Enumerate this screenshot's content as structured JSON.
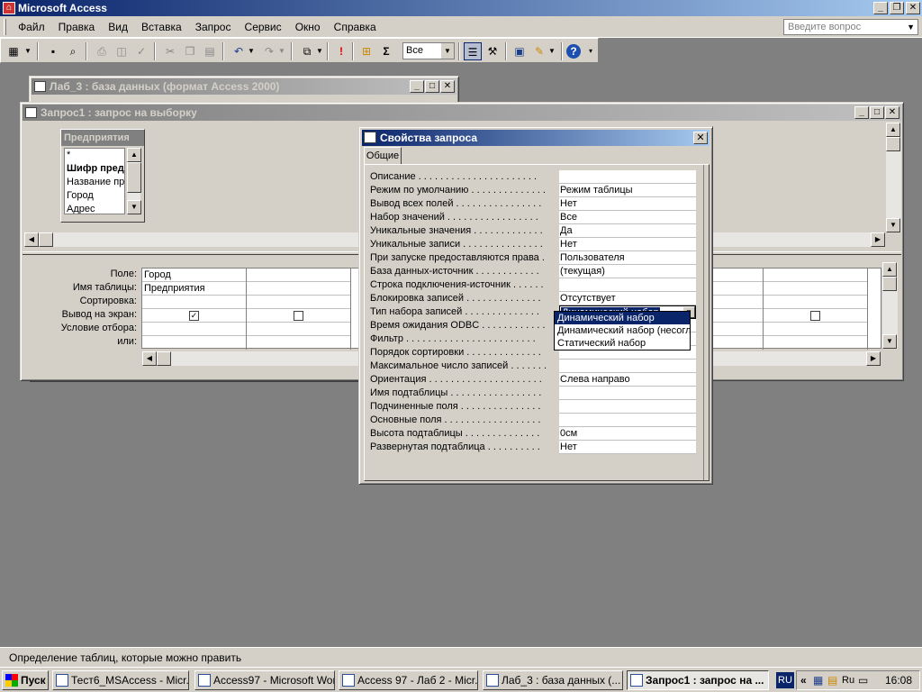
{
  "app": {
    "title": "Microsoft Access"
  },
  "menu": [
    "Файл",
    "Правка",
    "Вид",
    "Вставка",
    "Запрос",
    "Сервис",
    "Окно",
    "Справка"
  ],
  "ask_placeholder": "Введите вопрос",
  "toolbar": {
    "combo_value": "Все",
    "sigma": "Σ",
    "exclaim": "!",
    "help": "?"
  },
  "db_window": {
    "title": "Лаб_3 : база данных (формат Access 2000)"
  },
  "query_window": {
    "title": "Запрос1 : запрос на выборку",
    "field_list": {
      "title": "Предприятия",
      "items": [
        "*",
        "Шифр предп",
        "Название пре",
        "Город",
        "Адрес"
      ]
    },
    "grid_labels": [
      "Поле:",
      "Имя таблицы:",
      "Сортировка:",
      "Вывод на экран:",
      "Условие отбора:",
      "или:"
    ],
    "columns": [
      {
        "field": "Город",
        "table": "Предприятия",
        "show_mark": "✓"
      }
    ]
  },
  "properties": {
    "title": "Свойства запроса",
    "tab": "Общие",
    "rows": [
      {
        "label": "Описание . . . . . . . . . . . . . . . . . . . . . .",
        "value": ""
      },
      {
        "label": "Режим по умолчанию . . . . . . . . . . . . . .",
        "value": "Режим таблицы"
      },
      {
        "label": "Вывод всех полей . . . . . . . . . . . . . . . .",
        "value": "Нет"
      },
      {
        "label": "Набор значений . . . . . . . . . . . . . . . . .",
        "value": "Все"
      },
      {
        "label": "Уникальные значения . . . . . . . . . . . . .",
        "value": "Да"
      },
      {
        "label": "Уникальные записи . . . . . . . . . . . . . . .",
        "value": "Нет"
      },
      {
        "label": "При запуске предоставляются права .",
        "value": "Пользователя"
      },
      {
        "label": "База данных-источник . . . . . . . . . . . .",
        "value": "(текущая)"
      },
      {
        "label": "Строка подключения-источник . . . . . .",
        "value": ""
      },
      {
        "label": "Блокировка записей . . . . . . . . . . . . . .",
        "value": "Отсутствует"
      },
      {
        "label": "Тип набора записей . . . . . . . . . . . . . .",
        "value": "Динамический набор"
      },
      {
        "label": "Время ожидания ODBC . . . . . . . . . . . .",
        "value": ""
      },
      {
        "label": "Фильтр . . . . . . . . . . . . . . . . . . . . . . . .",
        "value": ""
      },
      {
        "label": "Порядок сортировки . . . . . . . . . . . . . .",
        "value": ""
      },
      {
        "label": "Максимальное число записей . . . . . . .",
        "value": ""
      },
      {
        "label": "Ориентация . . . . . . . . . . . . . . . . . . . . .",
        "value": "Слева направо"
      },
      {
        "label": "Имя подтаблицы . . . . . . . . . . . . . . . . .",
        "value": ""
      },
      {
        "label": "Подчиненные поля . . . . . . . . . . . . . . .",
        "value": ""
      },
      {
        "label": "Основные поля . . . . . . . . . . . . . . . . . .",
        "value": ""
      },
      {
        "label": "Высота подтаблицы . . . . . . . . . . . . . .",
        "value": "0см"
      },
      {
        "label": "Развернутая подтаблица . . . . . . . . . .",
        "value": "Нет"
      }
    ],
    "dropdown_options": [
      "Динамический набор",
      "Динамический набор (несогласованные изменения)",
      "Статический набор"
    ]
  },
  "status_text": "Определение таблиц, которые можно править",
  "taskbar": {
    "start": "Пуск",
    "tasks": [
      "Тест6_MSAccess - Micr...",
      "Access97 - Microsoft Word",
      "Access 97 - Лаб 2 - Micr...",
      "Лаб_3 : база данных (...",
      "Запрос1 : запрос на ..."
    ],
    "lang": "RU",
    "tray_lang": "Ru",
    "clock": "16:08"
  },
  "colors": {
    "active_title": "#0a246a",
    "inactive_title": "#808080",
    "face": "#d4d0c8",
    "desktop": "#808080"
  }
}
